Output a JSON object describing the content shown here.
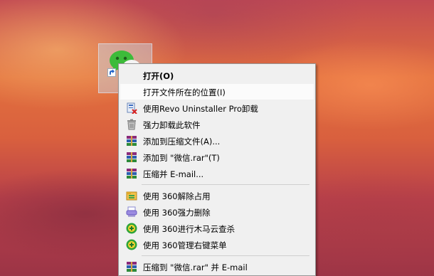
{
  "desktop": {
    "icon": {
      "name": "wechat-icon"
    }
  },
  "context_menu": {
    "items": [
      {
        "label": "打开(O)",
        "icon": ""
      },
      {
        "label": "打开文件所在的位置(I)",
        "icon": ""
      },
      {
        "label": "使用Revo Uninstaller Pro卸载",
        "icon": "revo-uninstaller-icon"
      },
      {
        "label": "强力卸载此软件",
        "icon": "trash-icon"
      },
      {
        "label": "添加到压缩文件(A)...",
        "icon": "winrar-icon"
      },
      {
        "label": "添加到 \"微信.rar\"(T)",
        "icon": "winrar-icon"
      },
      {
        "label": "压缩并 E-mail...",
        "icon": "winrar-icon"
      },
      {
        "label": "使用 360解除占用",
        "icon": "unlock-file-icon"
      },
      {
        "label": "使用 360强力删除",
        "icon": "shredder-icon"
      },
      {
        "label": "使用 360进行木马云查杀",
        "icon": "360-shield-icon"
      },
      {
        "label": "使用 360管理右键菜单",
        "icon": "360-shield-icon"
      },
      {
        "label": "压缩到 \"微信.rar\" 并 E-mail",
        "icon": "winrar-icon"
      }
    ]
  },
  "colors": {
    "menu_bg": "#f0f0f0",
    "menu_hover": "#fbfbfb",
    "wechat_green": "#3dbb3a"
  }
}
